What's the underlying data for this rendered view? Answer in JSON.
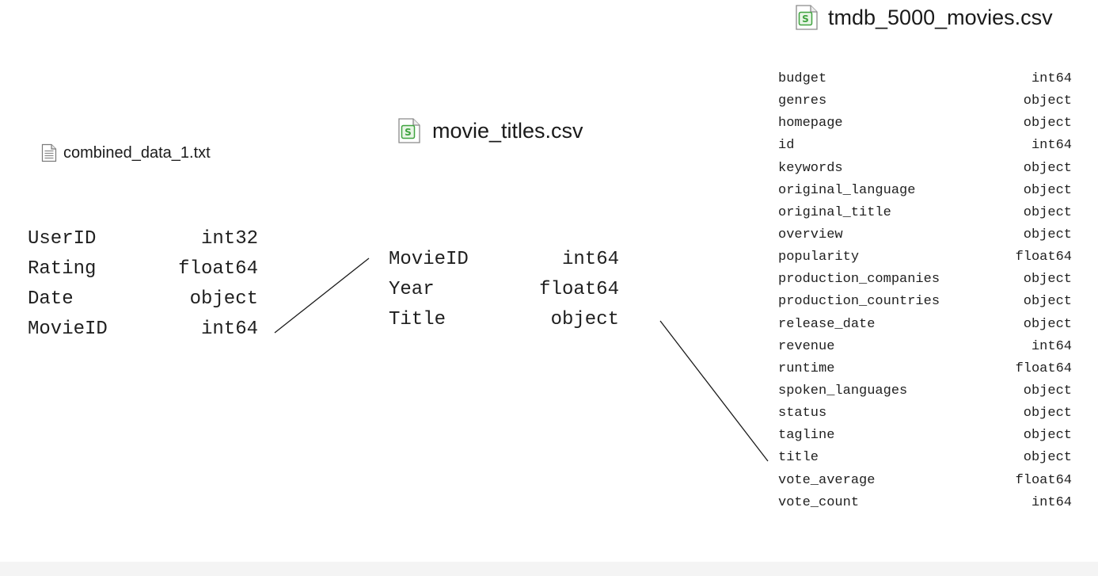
{
  "files": {
    "combined": {
      "icon": "text-file-icon",
      "name": "combined_data_1.txt",
      "columns": [
        {
          "name": "UserID",
          "dtype": "int32"
        },
        {
          "name": "Rating",
          "dtype": "float64"
        },
        {
          "name": "Date",
          "dtype": "object"
        },
        {
          "name": "MovieID",
          "dtype": "int64"
        }
      ]
    },
    "movie_titles": {
      "icon": "spreadsheet-file-icon",
      "name": "movie_titles.csv",
      "columns": [
        {
          "name": "MovieID",
          "dtype": "int64"
        },
        {
          "name": "Year",
          "dtype": "float64"
        },
        {
          "name": "Title",
          "dtype": "object"
        }
      ]
    },
    "tmdb": {
      "icon": "spreadsheet-file-icon",
      "name": "tmdb_5000_movies.csv",
      "columns": [
        {
          "name": "budget",
          "dtype": "int64"
        },
        {
          "name": "genres",
          "dtype": "object"
        },
        {
          "name": "homepage",
          "dtype": "object"
        },
        {
          "name": "id",
          "dtype": "int64"
        },
        {
          "name": "keywords",
          "dtype": "object"
        },
        {
          "name": "original_language",
          "dtype": "object"
        },
        {
          "name": "original_title",
          "dtype": "object"
        },
        {
          "name": "overview",
          "dtype": "object"
        },
        {
          "name": "popularity",
          "dtype": "float64"
        },
        {
          "name": "production_companies",
          "dtype": "object"
        },
        {
          "name": "production_countries",
          "dtype": "object"
        },
        {
          "name": "release_date",
          "dtype": "object"
        },
        {
          "name": "revenue",
          "dtype": "int64"
        },
        {
          "name": "runtime",
          "dtype": "float64"
        },
        {
          "name": "spoken_languages",
          "dtype": "object"
        },
        {
          "name": "status",
          "dtype": "object"
        },
        {
          "name": "tagline",
          "dtype": "object"
        },
        {
          "name": "title",
          "dtype": "object"
        },
        {
          "name": "vote_average",
          "dtype": "float64"
        },
        {
          "name": "vote_count",
          "dtype": "int64"
        }
      ]
    }
  },
  "links": [
    {
      "from": "combined_data_1.txt.MovieID",
      "to": "movie_titles.csv.MovieID"
    },
    {
      "from": "movie_titles.csv.Title",
      "to": "tmdb_5000_movies.csv.title"
    }
  ],
  "colors": {
    "csv_icon_green": "#3fa33f",
    "line": "#1a1a1a",
    "text": "#1f1f1f",
    "bottom_strip": "#f4f4f4"
  }
}
